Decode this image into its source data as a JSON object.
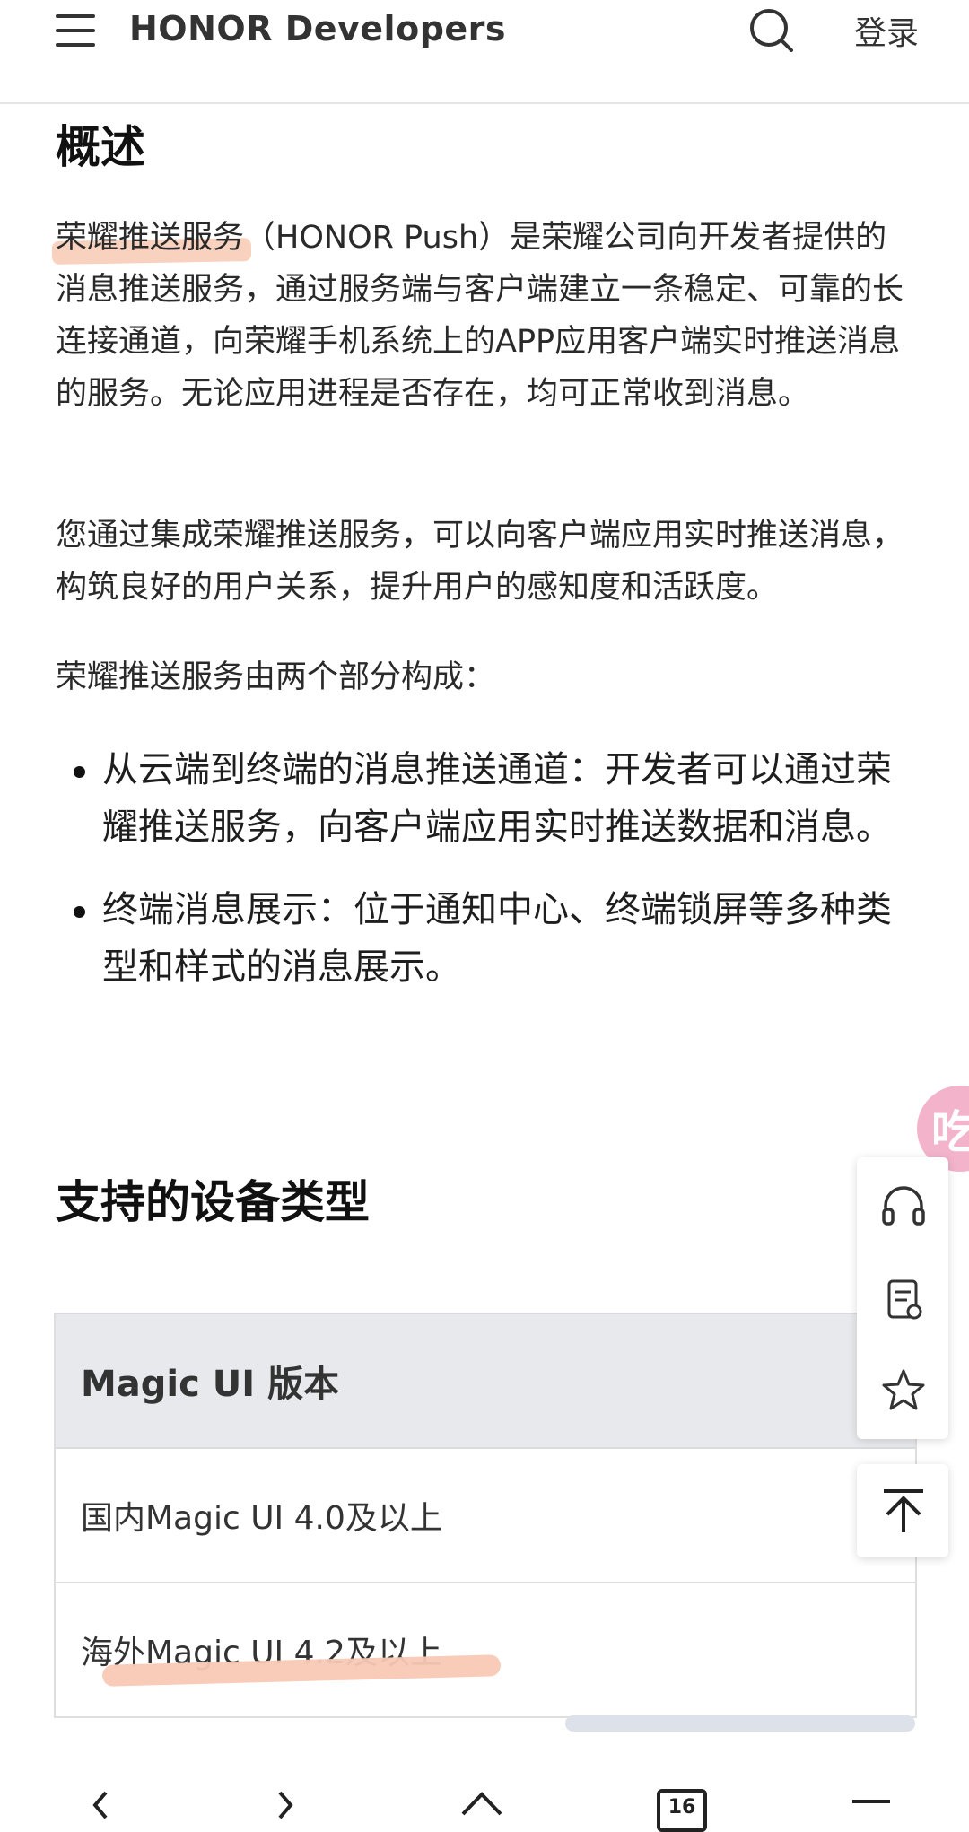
{
  "header": {
    "brand": "HONOR Developers",
    "login_label": "登录"
  },
  "overview": {
    "title": "概述",
    "p1_highlight": "荣耀推送服务",
    "p1_rest": "（HONOR Push）是荣耀公司向开发者提供的消息推送服务，通过服务端与客户端建立一条稳定、可靠的长连接通道，向荣耀手机系统上的APP应用客户端实时推送消息的服务。无论应用进程是否存在，均可正常收到消息。",
    "p2": "您通过集成荣耀推送服务，可以向客户端应用实时推送消息，构筑良好的用户关系，提升用户的感知度和活跃度。",
    "p3": "荣耀推送服务由两个部分构成：",
    "bullets": [
      "从云端到终端的消息推送通道：开发者可以通过荣耀推送服务，向客户端应用实时推送数据和消息。",
      "终端消息展示：位于通知中心、终端锁屏等多种类型和样式的消息展示。"
    ]
  },
  "devices": {
    "title": "支持的设备类型",
    "table_header": "Magic UI 版本",
    "rows": [
      "国内Magic UI 4.0及以上",
      "海外Magic UI 4.2及以上"
    ]
  },
  "bubble_text": "吃",
  "bottom_nav": {
    "tabs_count": "16"
  },
  "colors": {
    "highlight": "#f8c9b4",
    "table_header_bg": "#e7e9ec",
    "bubble": "#f3b4cb"
  }
}
